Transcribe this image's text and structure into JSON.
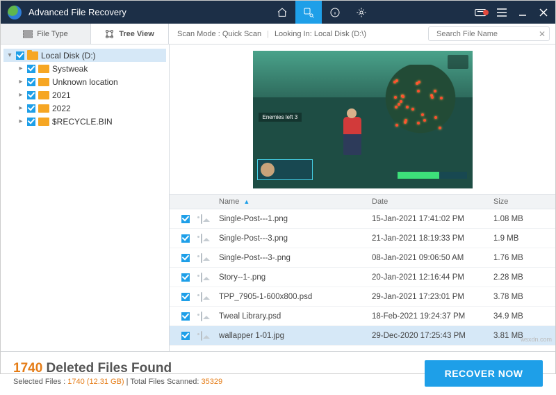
{
  "app": {
    "title": "Advanced File Recovery"
  },
  "toolbar": {
    "tabs": {
      "file_type": "File Type",
      "tree_view": "Tree View"
    },
    "scan_mode_label": "Scan Mode :",
    "scan_mode_value": "Quick Scan",
    "looking_in_label": "Looking In:",
    "looking_in_value": "Local Disk (D:\\)",
    "search_placeholder": "Search File Name"
  },
  "tree": [
    {
      "indent": 0,
      "arrow": "▾",
      "label": "Local Disk (D:)",
      "selected": true,
      "open": true
    },
    {
      "indent": 1,
      "arrow": "▸",
      "label": "Systweak"
    },
    {
      "indent": 1,
      "arrow": "▸",
      "label": "Unknown location"
    },
    {
      "indent": 1,
      "arrow": "▸",
      "label": "2021"
    },
    {
      "indent": 1,
      "arrow": "▸",
      "label": "2022"
    },
    {
      "indent": 1,
      "arrow": "▸",
      "label": "$RECYCLE.BIN"
    }
  ],
  "preview": {
    "hud_text": "Enemies left   3"
  },
  "table": {
    "headers": {
      "name": "Name",
      "date": "Date",
      "size": "Size"
    },
    "rows": [
      {
        "name": "Single-Post---1.png",
        "date": "15-Jan-2021 17:41:02 PM",
        "size": "1.08 MB"
      },
      {
        "name": "Single-Post---3.png",
        "date": "21-Jan-2021 18:19:33 PM",
        "size": "1.9 MB"
      },
      {
        "name": "Single-Post---3-.png",
        "date": "08-Jan-2021 09:06:50 AM",
        "size": "1.76 MB"
      },
      {
        "name": "Story--1-.png",
        "date": "20-Jan-2021 12:16:44 PM",
        "size": "2.28 MB"
      },
      {
        "name": "TPP_7905-1-600x800.psd",
        "date": "29-Jan-2021 17:23:01 PM",
        "size": "3.78 MB"
      },
      {
        "name": "Tweal Library.psd",
        "date": "18-Feb-2021 19:24:37 PM",
        "size": "34.9 MB"
      },
      {
        "name": "wallapper 1-01.jpg",
        "date": "29-Dec-2020 17:25:43 PM",
        "size": "3.81 MB",
        "selected": true
      }
    ]
  },
  "footer": {
    "count": "1740",
    "count_suffix": " Deleted Files Found",
    "selected_label": "Selected Files : ",
    "selected_value": "1740 (12.31 GB)",
    "sep": " | ",
    "scanned_label": "Total Files Scanned: ",
    "scanned_value": "35329",
    "recover_btn": "RECOVER NOW"
  },
  "watermark": "wsxdn.com"
}
